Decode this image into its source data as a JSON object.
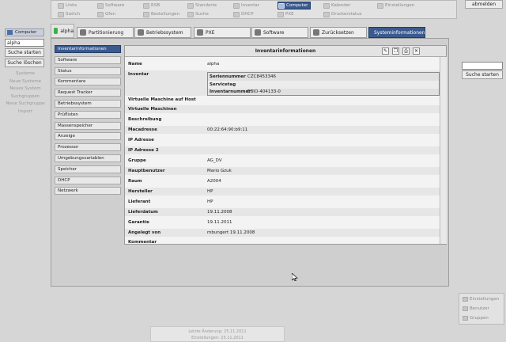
{
  "top_menu": [
    {
      "label": "Links",
      "active": false
    },
    {
      "label": "Software",
      "active": false
    },
    {
      "label": "RSB",
      "active": false
    },
    {
      "label": "Standorte",
      "active": false
    },
    {
      "label": "Inventar",
      "active": false
    },
    {
      "label": "Computer",
      "active": true
    },
    {
      "label": "Kalender",
      "active": false
    },
    {
      "label": "Einstellungen",
      "active": false
    },
    {
      "label": "Switch",
      "active": false
    },
    {
      "label": "Gfen",
      "active": false
    },
    {
      "label": "Bestellungen",
      "active": false
    },
    {
      "label": "Suche",
      "active": false
    },
    {
      "label": "DHCP",
      "active": false
    },
    {
      "label": "PXE",
      "active": false
    },
    {
      "label": "Druckerstatus",
      "active": false
    }
  ],
  "logout_label": "abmelden",
  "left_panel": {
    "title": "Computer",
    "search_value": "alpha",
    "search_button": "Suche starten",
    "clear_button": "Suche löschen",
    "links": [
      "Systeme",
      "Neue Systeme",
      "Neues System",
      "Suchgruppen",
      "Neue Suchgruppe",
      "Import"
    ]
  },
  "tabs": {
    "host": "alpha",
    "items": [
      {
        "label": "Partitionierung",
        "active": false
      },
      {
        "label": "Betriebssystem",
        "active": false
      },
      {
        "label": "PXE",
        "active": false
      },
      {
        "label": "Software",
        "active": false
      },
      {
        "label": "Zurücksetzen",
        "active": false
      },
      {
        "label": "Systeminformationen",
        "active": true
      }
    ]
  },
  "submenu": [
    {
      "label": "Inventarinformationen",
      "active": true
    },
    {
      "label": "Software",
      "active": false
    },
    {
      "label": "Status",
      "active": false
    },
    {
      "label": "Kommentare",
      "active": false
    },
    {
      "label": "Request Tracker",
      "active": false
    },
    {
      "label": "Betriebssystem",
      "active": false
    },
    {
      "label": "Prüflisten",
      "active": false
    },
    {
      "label": "Massenspeicher",
      "active": false
    },
    {
      "label": "Anzeige",
      "active": false
    },
    {
      "label": "Prozessor",
      "active": false
    },
    {
      "label": "Umgebungsvariablen",
      "active": false
    },
    {
      "label": "Speicher",
      "active": false
    },
    {
      "label": "DHCP",
      "active": false
    },
    {
      "label": "Netzwerk",
      "active": false
    }
  ],
  "info": {
    "title": "Inventarinformationen",
    "rows": [
      {
        "label": "Name",
        "value": "alpha"
      },
      {
        "label": "Inventar",
        "value": ""
      },
      {
        "label": "Virtuelle Maschine auf Host",
        "value": ""
      },
      {
        "label": "Virtuelle Maschinen",
        "value": ""
      },
      {
        "label": "Beschreibung",
        "value": ""
      },
      {
        "label": "Macadresse",
        "value": "00:22:64:90:b9:11"
      },
      {
        "label": "IP Adresse",
        "value": ""
      },
      {
        "label": "IP Adresse 2",
        "value": ""
      },
      {
        "label": "Gruppe",
        "value": "AG_DV"
      },
      {
        "label": "Hauptbenutzer",
        "value": "Mario Gzuk"
      },
      {
        "label": "Raum",
        "value": "A2004"
      },
      {
        "label": "Hersteller",
        "value": "HP"
      },
      {
        "label": "Lieferant",
        "value": "HP"
      },
      {
        "label": "Lieferdatum",
        "value": "19.11.2008"
      },
      {
        "label": "Garantie",
        "value": "19.11.2011"
      },
      {
        "label": "Angelegt von",
        "value": "mbungert 19.11.2008"
      },
      {
        "label": "Kommentar",
        "value": ""
      }
    ],
    "inventory": [
      {
        "key": "Seriennummer",
        "value": "CZC8453346"
      },
      {
        "key": "Servicetag",
        "value": ""
      },
      {
        "key": "Inventarnummer",
        "value": "EBIO-404133-0"
      }
    ]
  },
  "right": {
    "search_button": "Suche starten"
  },
  "bottom_right": [
    "Einstellungen",
    "Benutzer",
    "Gruppen"
  ],
  "footer": [
    "Letzte Änderung: 25.11.2011",
    "Einstellungen: 25.11.2011"
  ],
  "colors": {
    "accent": "#3a5a8f",
    "background": "#d6d6d6",
    "panel": "#f3f3f3"
  }
}
